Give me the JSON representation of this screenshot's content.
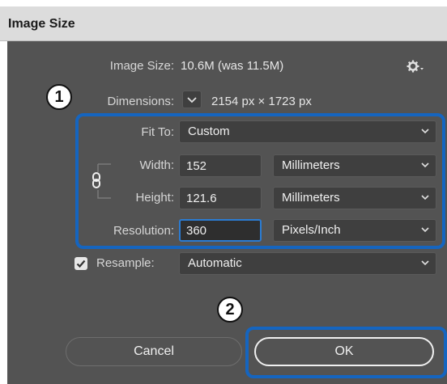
{
  "dialog": {
    "title": "Image Size",
    "image_size_label": "Image Size:",
    "image_size_value": "10.6M (was 11.5M)",
    "dimensions_label": "Dimensions:",
    "dimensions_value": "2154 px  ×  1723 px",
    "fit_to_label": "Fit To:",
    "fit_to_value": "Custom",
    "width_label": "Width:",
    "width_value": "152",
    "width_unit": "Millimeters",
    "height_label": "Height:",
    "height_value": "121.6",
    "height_unit": "Millimeters",
    "resolution_label": "Resolution:",
    "resolution_value": "360",
    "resolution_unit": "Pixels/Inch",
    "resample_label": "Resample:",
    "resample_checked": true,
    "resample_value": "Automatic",
    "cancel_label": "Cancel",
    "ok_label": "OK"
  },
  "annotations": {
    "marker_1": "1",
    "marker_2": "2"
  },
  "colors": {
    "panel_bg": "#535353",
    "highlight_blue": "#1565c0",
    "focus_blue": "#2b7cd3"
  },
  "icons": [
    "gear-icon",
    "chevron-down-icon",
    "chain-link-icon",
    "checkmark-icon"
  ]
}
